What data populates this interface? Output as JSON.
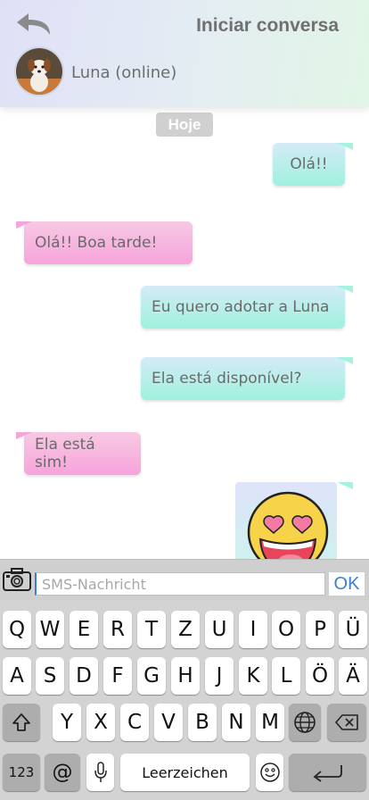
{
  "header": {
    "title": "Iniciar conversa",
    "contact_name": "Luna (online)",
    "back_icon": "back-arrow-icon",
    "avatar_icon": "dog-avatar"
  },
  "chat": {
    "date_badge": "Hoje",
    "messages": [
      {
        "direction": "sent",
        "text": "Olá!!"
      },
      {
        "direction": "received",
        "text": "Olá!! Boa tarde!"
      },
      {
        "direction": "sent",
        "text": "Eu quero adotar a Luna"
      },
      {
        "direction": "sent",
        "text": "Ela está disponível?"
      },
      {
        "direction": "received",
        "text": "Ela está sim!"
      },
      {
        "direction": "sent",
        "emoji": "heart-eyes-emoji"
      }
    ]
  },
  "input_bar": {
    "camera_icon": "camera-icon",
    "placeholder": "SMS-Nachricht",
    "ok_label": "OK"
  },
  "keyboard": {
    "row1": [
      "Q",
      "W",
      "E",
      "R",
      "T",
      "Z",
      "U",
      "I",
      "O",
      "P",
      "Ü"
    ],
    "row2": [
      "A",
      "S",
      "D",
      "F",
      "G",
      "H",
      "J",
      "K",
      "L",
      "Ö",
      "Ä"
    ],
    "row3": [
      "Y",
      "X",
      "C",
      "V",
      "B",
      "N",
      "M"
    ],
    "numbers_label": "123",
    "at_label": "@",
    "space_label": "Leerzeichen",
    "shift_icon": "shift-icon",
    "globe_icon": "globe-icon",
    "backspace_icon": "backspace-icon",
    "mic_icon": "microphone-icon",
    "emoji_icon": "smiley-icon",
    "return_icon": "return-icon"
  },
  "colors": {
    "sent_bubble": "#9ff1df",
    "received_bubble": "#f7a3dc",
    "accent": "#3a7fd0"
  }
}
